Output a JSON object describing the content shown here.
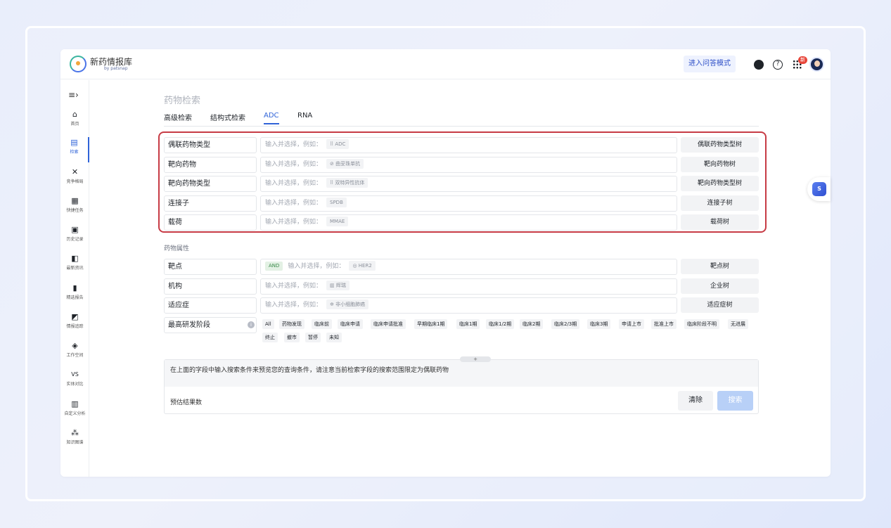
{
  "app": {
    "brand": "新药情报库",
    "brand_sub": "by patsnap",
    "qa_mode_button": "进入问答模式",
    "new_badge": "新"
  },
  "sidebar": {
    "items": [
      {
        "label": "首页",
        "icon": "home-icon"
      },
      {
        "label": "检索",
        "icon": "search-doc-icon"
      },
      {
        "label": "竞争格局",
        "icon": "cross-icon"
      },
      {
        "label": "快捷任务",
        "icon": "task-icon"
      },
      {
        "label": "历史记录",
        "icon": "history-icon"
      },
      {
        "label": "最新资讯",
        "icon": "news-icon"
      },
      {
        "label": "精选报告",
        "icon": "report-icon"
      },
      {
        "label": "情报追踪",
        "icon": "track-icon"
      },
      {
        "label": "工作空间",
        "icon": "workspace-icon"
      },
      {
        "label": "实体对比",
        "icon": "vs-icon"
      },
      {
        "label": "自定义分析",
        "icon": "analysis-icon"
      },
      {
        "label": "知识图谱",
        "icon": "graph-icon"
      }
    ]
  },
  "main": {
    "title": "药物检索",
    "tabs": [
      "高级检索",
      "结构式检索",
      "ADC",
      "RNA"
    ],
    "active_tab": "ADC",
    "fields": [
      {
        "label": "偶联药物类型",
        "placeholder": "输入并选择，例如：",
        "example": "ADC",
        "tree": "偶联药物类型树"
      },
      {
        "label": "靶向药物",
        "placeholder": "输入并选择，例如：",
        "example": "曲妥珠单抗",
        "tree": "靶向药物树"
      },
      {
        "label": "靶向药物类型",
        "placeholder": "输入并选择，例如：",
        "example": "双特异性抗体",
        "tree": "靶向药物类型树"
      },
      {
        "label": "连接子",
        "placeholder": "输入并选择，例如：",
        "example": "SPDB",
        "tree": "连接子树"
      },
      {
        "label": "载荷",
        "placeholder": "输入并选择，例如：",
        "example": "MMAE",
        "tree": "载荷树"
      }
    ],
    "attr_section": "药物属性",
    "attrs": [
      {
        "label": "靶点",
        "operator": "AND",
        "placeholder": "输入并选择，例如：",
        "example": "HER2",
        "tree": "靶点树"
      },
      {
        "label": "机构",
        "placeholder": "输入并选择，例如：",
        "example": "辉瑞",
        "tree": "企业树"
      },
      {
        "label": "适应症",
        "placeholder": "输入并选择，例如：",
        "example": "非小细胞肺癌",
        "tree": "适应症树"
      }
    ],
    "stage_label": "最高研发阶段",
    "stages": [
      "All",
      "药物发现",
      "临床前",
      "临床申请",
      "临床申请批准",
      "早期临床1期",
      "临床1期",
      "临床1/2期",
      "临床2期",
      "临床2/3期",
      "临床3期",
      "申请上市",
      "批准上市",
      "临床阶段不明",
      "无进展",
      "终止",
      "撤市",
      "暂停",
      "未知"
    ],
    "expand_handle": "+",
    "preview_hint": "在上面的字段中输入搜索条件来预览您的查询条件，请注意当前检索字段的搜索范围限定为偶联药物",
    "estimate_label": "预估结果数",
    "clear_button": "清除",
    "search_button": "搜索"
  },
  "float_widget": "S"
}
